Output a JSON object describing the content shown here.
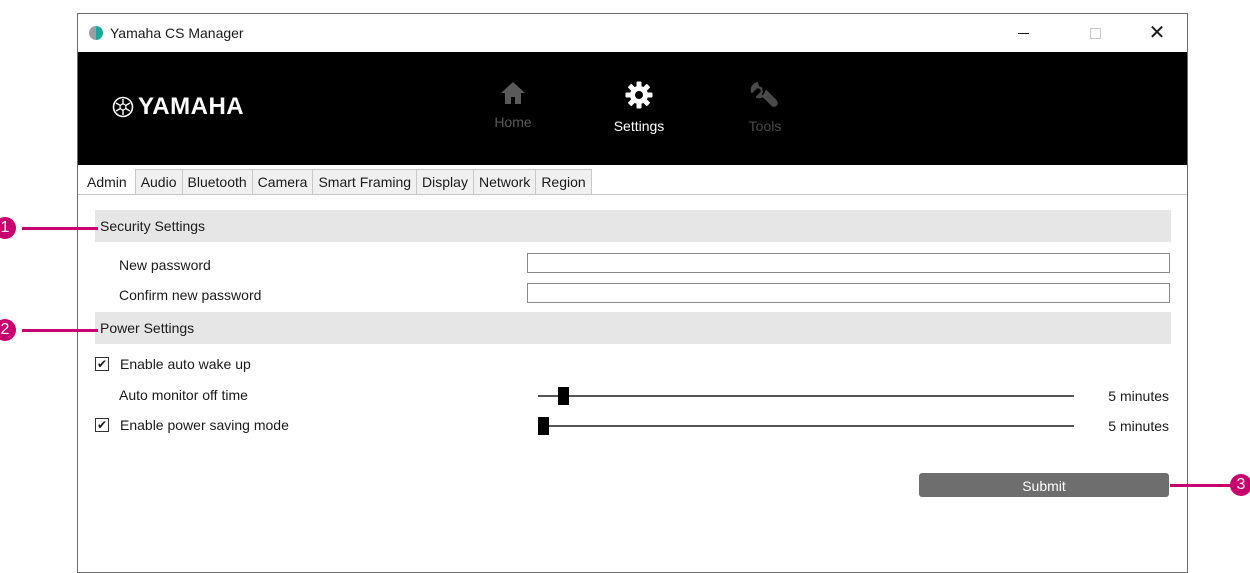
{
  "window": {
    "title": "Yamaha CS Manager",
    "controls": {
      "minimize": "—",
      "maximize": "☐",
      "close": "✕"
    }
  },
  "header": {
    "logo_text": "YAMAHA",
    "nav": [
      {
        "label": "Home",
        "icon": "home-icon",
        "state": "inactive"
      },
      {
        "label": "Settings",
        "icon": "gear-icon",
        "state": "active"
      },
      {
        "label": "Tools",
        "icon": "wrench-icon",
        "state": "inactive"
      }
    ]
  },
  "tabs": [
    "Admin",
    "Audio",
    "Bluetooth",
    "Camera",
    "Smart Framing",
    "Display",
    "Network",
    "Region"
  ],
  "active_tab": "Admin",
  "security": {
    "title": "Security Settings",
    "new_password_label": "New password",
    "new_password_value": "",
    "confirm_password_label": "Confirm new password",
    "confirm_password_value": ""
  },
  "power": {
    "title": "Power Settings",
    "auto_wake_label": "Enable auto wake up",
    "auto_wake_checked": true,
    "auto_monitor_label": "Auto monitor off time",
    "auto_monitor_value": "5 minutes",
    "auto_monitor_fraction": 0.03,
    "power_saving_label": "Enable power saving mode",
    "power_saving_checked": true,
    "power_saving_value": "5 minutes",
    "power_saving_fraction": 0.0
  },
  "submit_label": "Submit",
  "callouts": [
    "1",
    "2",
    "3"
  ],
  "colors": {
    "header_bg": "#000000",
    "section_bg": "#e6e6e6",
    "submit_bg": "#6e6e6e",
    "callout": "#c8006e"
  }
}
